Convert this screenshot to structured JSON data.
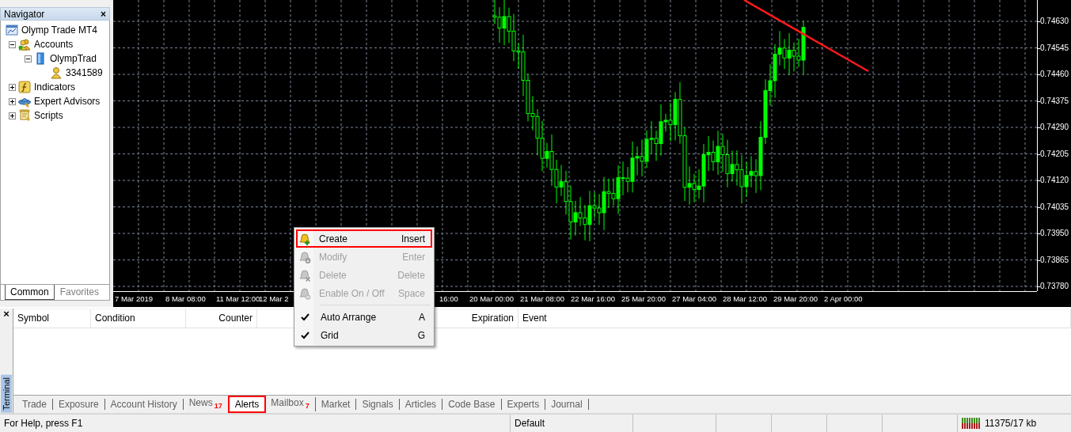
{
  "navigator": {
    "title": "Navigator",
    "close": "×",
    "root": {
      "label": "Olymp Trade MT4",
      "items": [
        {
          "label": "Accounts",
          "expanded": true,
          "children": [
            {
              "label": "OlympTrad",
              "expanded": true,
              "children": [
                {
                  "label": "3341589"
                }
              ]
            }
          ]
        },
        {
          "label": "Indicators",
          "expanded": false
        },
        {
          "label": "Expert Advisors",
          "expanded": false
        },
        {
          "label": "Scripts",
          "expanded": false
        }
      ]
    },
    "tabs": [
      {
        "label": "Common",
        "selected": true
      },
      {
        "label": "Favorites",
        "selected": false
      }
    ]
  },
  "chart": {
    "price_axis": [
      "0.74630",
      "0.74545",
      "0.74460",
      "0.74375",
      "0.74290",
      "0.74205",
      "0.74120",
      "0.74035",
      "0.73950",
      "0.73865",
      "0.73780"
    ],
    "time_axis": [
      "7 Mar 2019",
      "8 Mar 08:00",
      "11 Mar 12:00",
      "12 Mar 2",
      "16:00",
      "20 Mar 00:00",
      "21 Mar 08:00",
      "22 Mar 16:00",
      "25 Mar 20:00",
      "27 Mar 04:00",
      "28 Mar 12:00",
      "29 Mar 20:00",
      "2 Apr 00:00"
    ]
  },
  "context_menu": {
    "items": [
      {
        "kind": "action",
        "label": "Create",
        "shortcut": "Insert",
        "disabled": false,
        "highlighted": true
      },
      {
        "kind": "action",
        "label": "Modify",
        "shortcut": "Enter",
        "disabled": true,
        "highlighted": false
      },
      {
        "kind": "action",
        "label": "Delete",
        "shortcut": "Delete",
        "disabled": true,
        "highlighted": false
      },
      {
        "kind": "action",
        "label": "Enable On / Off",
        "shortcut": "Space",
        "disabled": true,
        "highlighted": false
      },
      {
        "kind": "separator"
      },
      {
        "kind": "check",
        "label": "Auto Arrange",
        "shortcut": "A",
        "checked": true
      },
      {
        "kind": "check",
        "label": "Grid",
        "shortcut": "G",
        "checked": true
      }
    ]
  },
  "terminal": {
    "title": "Terminal",
    "close": "×",
    "columns": [
      "Symbol",
      "Condition",
      "Counter",
      "Expiration",
      "Event"
    ],
    "tabs": [
      {
        "label": "Trade",
        "selected": false,
        "highlighted": false
      },
      {
        "label": "Exposure",
        "selected": false,
        "highlighted": false
      },
      {
        "label": "Account History",
        "selected": false,
        "highlighted": false
      },
      {
        "label": "News",
        "count": "17",
        "selected": false,
        "highlighted": false
      },
      {
        "label": "Alerts",
        "selected": true,
        "highlighted": true
      },
      {
        "label": "Mailbox",
        "count": "7",
        "selected": false,
        "highlighted": false
      },
      {
        "label": "Market",
        "selected": false,
        "highlighted": false
      },
      {
        "label": "Signals",
        "selected": false,
        "highlighted": false
      },
      {
        "label": "Articles",
        "selected": false,
        "highlighted": false
      },
      {
        "label": "Code Base",
        "selected": false,
        "highlighted": false
      },
      {
        "label": "Experts",
        "selected": false,
        "highlighted": false
      },
      {
        "label": "Journal",
        "selected": false,
        "highlighted": false
      }
    ]
  },
  "status_bar": {
    "help": "For Help, press F1",
    "profile": "Default",
    "traffic": "11375/17 kb"
  }
}
